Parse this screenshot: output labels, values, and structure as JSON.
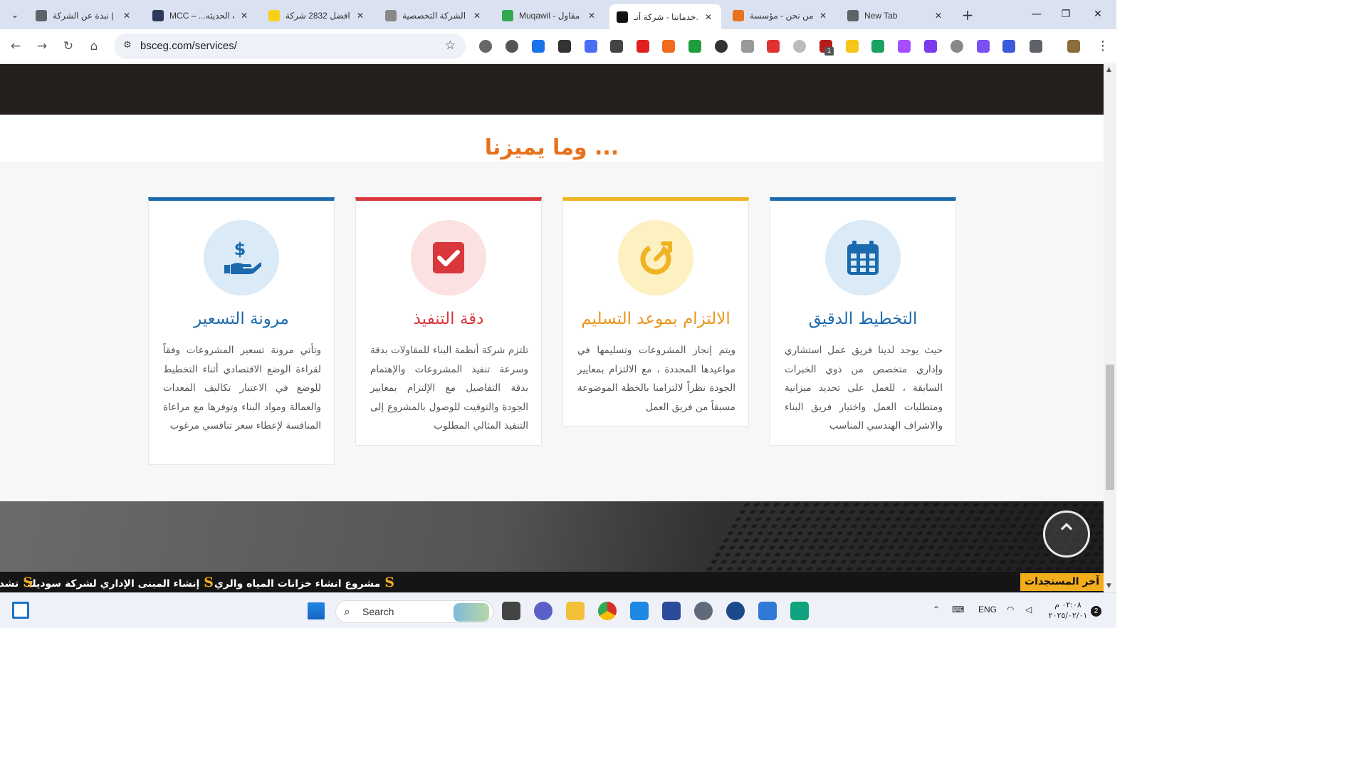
{
  "browser": {
    "tabs": [
      {
        "title": "نبذة عن الشركة | ...",
        "favicon_color": "#5f6368",
        "active": false
      },
      {
        "title": "MCC – ...ت الحديثه",
        "favicon_color": "#2d3a59",
        "active": false
      },
      {
        "title": "افضل 2832 شركة",
        "favicon_color": "#f7d118",
        "active": false
      },
      {
        "title": "الشركة التخصصية",
        "favicon_color": "#888888",
        "active": false
      },
      {
        "title": "Muqawil - مقاول",
        "favicon_color": "#33a852",
        "active": false
      },
      {
        "title": "خدماتنا - شركة أنـ...",
        "favicon_color": "#111111",
        "active": true
      },
      {
        "title": "من نحن - مؤسسة",
        "favicon_color": "#e8711b",
        "active": false
      },
      {
        "title": "New Tab",
        "favicon_color": "#5f6368",
        "active": false
      }
    ],
    "new_tab_label": "+",
    "url": "bsceg.com/services/",
    "extension_badge": "1"
  },
  "page": {
    "section_title": "وما يميزنا ...",
    "cards": [
      {
        "icon": "hand-dollar-icon",
        "title": "مرونة التسعير",
        "accent": "#1a6aad",
        "circle_bg": "#dbeaf7",
        "body": "وتأتي مرونة تسعير المشروعات وفقاً لقراءة الوضع الاقتصادي أثناء التخطيط للوضع في الاعتبار تكاليف المعدات والعمالة ومواد البناء وتوفرها مع مراعاة المنافسة لإعطاء سعر تنافسي مرغوب"
      },
      {
        "icon": "check-square-icon",
        "title": "دقة التنفيذ",
        "accent": "#d8373c",
        "circle_bg": "#fbe1e1",
        "body": "تلتزم شركة أنظمة البناء للمقاولات بدقة وسرعة تنفيذ المشروعات والإهتمام بدقة التفاصيل مع الإلتزام بمعايير الجودة والتوقيت للوصول بالمشروع إلى التنفيذ المثالي المطلوب"
      },
      {
        "icon": "stopwatch-icon",
        "title": "الالتزام بموعد التسليم",
        "accent": "#f0b323",
        "circle_bg": "#fdf0c1",
        "body": "ويتم إنجاز المشروعات وتسليمها في مواعيدها المحددة ، مع الالتزام بمعايير الجودة نظراً لالتزامنا بالخطة الموضوعة مسبقاً من فريق العمل"
      },
      {
        "icon": "calendar-icon",
        "title": "التخطيط الدقيق",
        "accent": "#1a6aad",
        "circle_bg": "#dbeaf7",
        "body": "حيث يوجد لدينا فريق عمل استشاري وإداري متخصص من ذوي الخبرات السابقة ، للعمل على تحديد ميزانية ومتطلبات العمل واختيار فريق البناء والاشراف الهندسي المناسب"
      }
    ],
    "scroll_top_icon": "chevron-up-icon"
  },
  "ticker": {
    "label": "آخر المستجدات",
    "items": [
      "مشروع انشاء خزانات المياه والري",
      "إنشاء المبنى الإداري لشركة سوديك",
      "تشد"
    ],
    "logo_letter": "S"
  },
  "taskbar": {
    "search_label": "Search",
    "language": "ENG",
    "time": "٠٢:٠٨ م",
    "date": "٢٠٢٥/٠٢/٠١",
    "notification_count": "2"
  }
}
